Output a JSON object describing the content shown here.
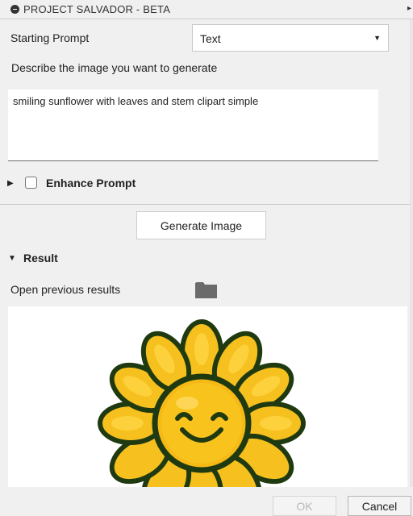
{
  "titlebar": {
    "title": "PROJECT SALVADOR - BETA"
  },
  "starting_prompt": {
    "label": "Starting Prompt",
    "selected": "Text"
  },
  "describe_label": "Describe the image you want to generate",
  "prompt_text": "smiling sunflower with leaves and stem clipart simple",
  "enhance": {
    "label": "Enhance Prompt",
    "checked": false
  },
  "generate_button": "Generate Image",
  "result": {
    "label": "Result",
    "open_previous": "Open previous results"
  },
  "footer": {
    "ok": "OK",
    "cancel": "Cancel"
  },
  "icons": {
    "title": "minus-circle-icon",
    "title_arrow": "caret-right-icon",
    "folder": "folder-icon"
  },
  "colors": {
    "petal": "#f6c01e",
    "petal_outline": "#1f3a10",
    "face": "#f7b915"
  }
}
